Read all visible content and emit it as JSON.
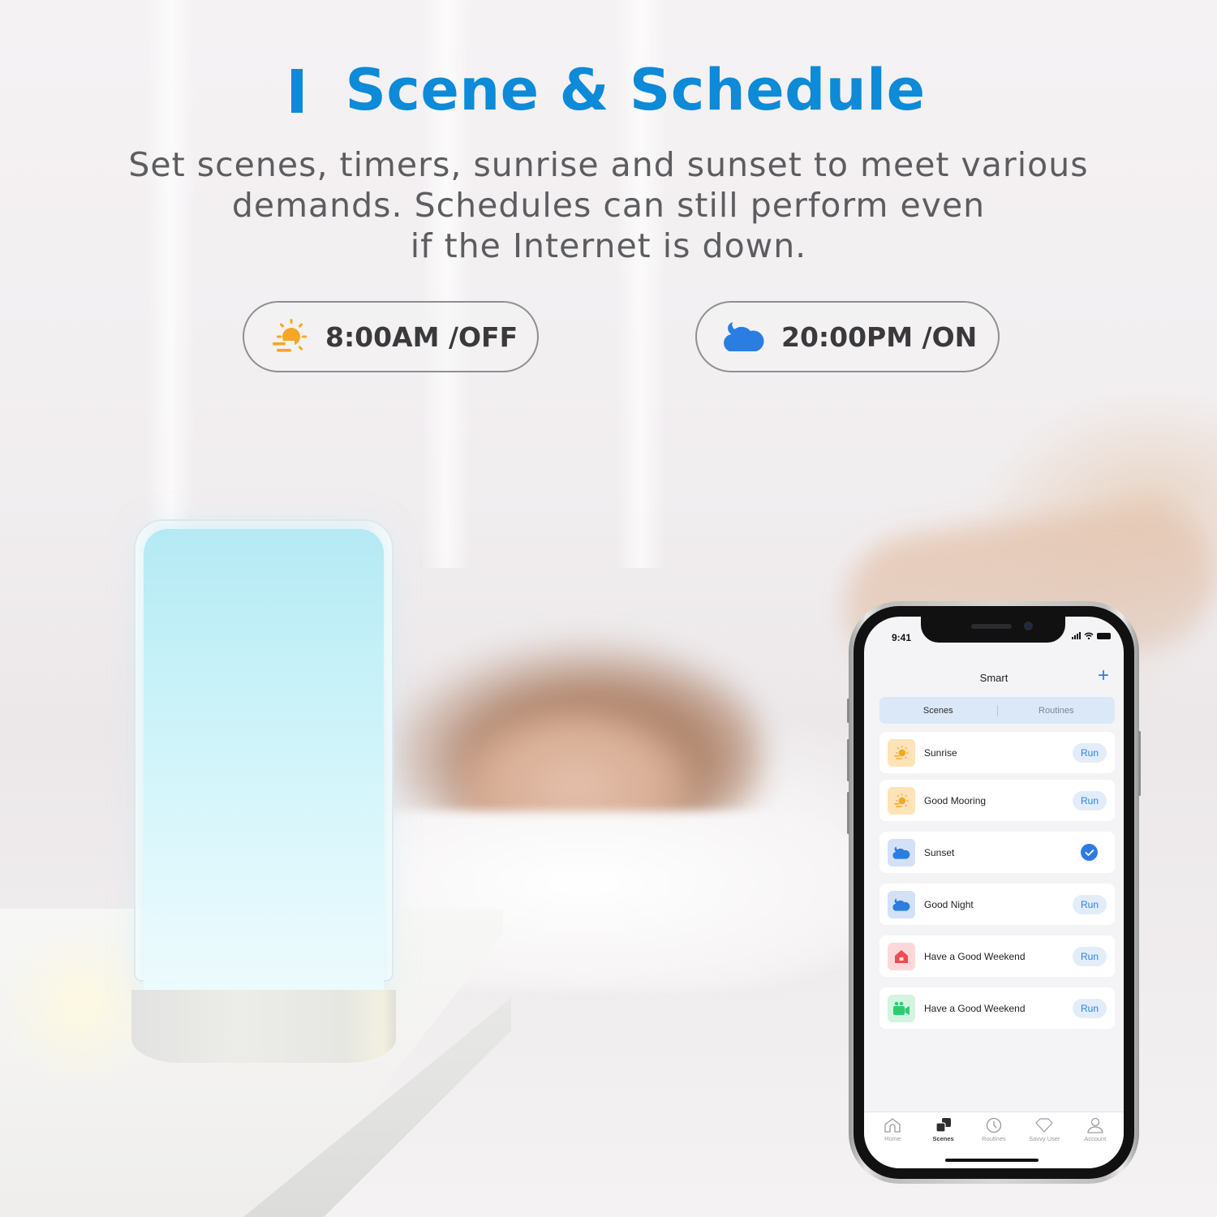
{
  "heading": {
    "title": "Scene & Schedule",
    "description_lines": [
      "Set scenes, timers, sunrise and sunset to meet various",
      "demands. Schedules can still perform even",
      "if the Internet is down."
    ],
    "accent_color": "#0d8ad8"
  },
  "schedules": [
    {
      "icon": "sunrise-icon",
      "label": "8:00AM /OFF",
      "icon_color": "#f5a623"
    },
    {
      "icon": "moon-cloud-icon",
      "label": "20:00PM /ON",
      "icon_color": "#2a7de1"
    }
  ],
  "phone": {
    "status_bar": {
      "time": "9:41"
    },
    "nav": {
      "title": "Smart",
      "add_button": "+"
    },
    "segments": [
      {
        "label": "Scenes",
        "active": true
      },
      {
        "label": "Routines",
        "active": false
      }
    ],
    "scenes": [
      {
        "name": "Sunrise",
        "icon": "sunrise-icon",
        "action": "Run",
        "state": "idle"
      },
      {
        "name": "Good Mooring",
        "icon": "sunrise-icon",
        "action": "Run",
        "state": "idle"
      },
      {
        "name": "Sunset",
        "icon": "moon-cloud-icon",
        "action": "",
        "state": "selected"
      },
      {
        "name": "Good Night",
        "icon": "moon-cloud-icon",
        "action": "Run",
        "state": "idle"
      },
      {
        "name": "Have a Good Weekend",
        "icon": "house-icon",
        "action": "Run",
        "state": "idle"
      },
      {
        "name": "Have a Good Weekend",
        "icon": "video-camera-icon",
        "action": "Run",
        "state": "idle"
      }
    ],
    "tabbar": [
      {
        "label": "Home",
        "icon": "home-icon",
        "active": false
      },
      {
        "label": "Scenes",
        "icon": "scenes-icon",
        "active": true
      },
      {
        "label": "Routines",
        "icon": "clock-icon",
        "active": false
      },
      {
        "label": "Savvy User",
        "icon": "diamond-icon",
        "active": false
      },
      {
        "label": "Account",
        "icon": "person-icon",
        "active": false
      }
    ],
    "colors": {
      "accent": "#2f7fd9",
      "sun_bg": "#fde3b8",
      "moon_bg": "#d3e1f6",
      "house_bg": "#fbd9db",
      "video_bg": "#d3f4e1"
    }
  }
}
